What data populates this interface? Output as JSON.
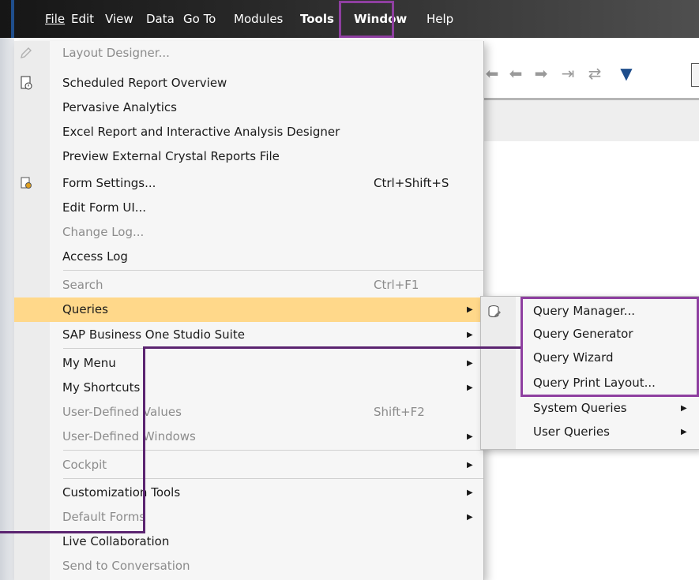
{
  "menubar": {
    "items": [
      {
        "label": "File"
      },
      {
        "label": "Edit"
      },
      {
        "label": "View"
      },
      {
        "label": "Data"
      },
      {
        "label": "Go To"
      },
      {
        "label": "Modules"
      },
      {
        "label": "Tools"
      },
      {
        "label": "Window"
      },
      {
        "label": "Help"
      }
    ]
  },
  "toolbar": {
    "icons": [
      "first-record-icon",
      "previous-record-icon",
      "next-record-icon",
      "last-record-icon",
      "refresh-icon",
      "filter-icon"
    ]
  },
  "tools_menu": {
    "items": [
      {
        "label": "Layout Designer...",
        "icon": "pencil-icon",
        "disabled": true
      },
      {
        "label": "Scheduled Report Overview",
        "icon": "report-icon"
      },
      {
        "label": "Pervasive Analytics"
      },
      {
        "label": "Excel Report and Interactive Analysis Designer"
      },
      {
        "label": "Preview External Crystal Reports File"
      },
      {
        "label": "Form Settings...",
        "shortcut": "Ctrl+Shift+S",
        "icon": "form-settings-icon"
      },
      {
        "label": "Edit Form UI..."
      },
      {
        "label": "Change Log...",
        "disabled": true
      },
      {
        "label": "Access Log"
      },
      {
        "label": "Search",
        "shortcut": "Ctrl+F1",
        "disabled": true
      },
      {
        "label": "Queries",
        "highlighted": true
      },
      {
        "label": "SAP Business One Studio Suite"
      },
      {
        "label": "My Menu"
      },
      {
        "label": "My Shortcuts"
      },
      {
        "label": "User-Defined Values",
        "shortcut": "Shift+F2",
        "disabled": true
      },
      {
        "label": "User-Defined Windows",
        "disabled": true
      },
      {
        "label": "Cockpit",
        "disabled": true
      },
      {
        "label": "Customization Tools"
      },
      {
        "label": "Default Forms",
        "disabled": true
      },
      {
        "label": "Live Collaboration"
      },
      {
        "label": "Send to Conversation",
        "disabled": true
      }
    ]
  },
  "queries_submenu": {
    "items": [
      {
        "label": "Query Manager...",
        "icon": "query-manager-icon"
      },
      {
        "label": "Query Generator"
      },
      {
        "label": "Query Wizard"
      },
      {
        "label": "Query Print Layout..."
      },
      {
        "label": "System Queries"
      },
      {
        "label": "User Queries"
      }
    ]
  },
  "colors": {
    "highlight": "#ffd88a",
    "annotation": "#8e3fa0"
  }
}
